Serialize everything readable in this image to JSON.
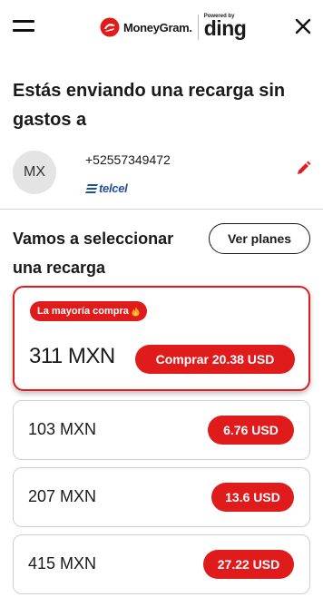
{
  "header": {
    "brand_name": "MoneyGram.",
    "powered_by": "Powered by",
    "partner": "ding"
  },
  "intro": {
    "title": "Estás enviando una recarga sin gastos a"
  },
  "contact": {
    "initials": "MX",
    "phone": "+52557349472",
    "operator": "telcel"
  },
  "plans": {
    "title": "Vamos a seleccionar una recarga",
    "view_plans_label": "Ver planes",
    "featured": {
      "badge": "La mayoría compra",
      "amount": "311 MXN",
      "button_label": "Comprar 20.38 USD"
    },
    "items": [
      {
        "amount": "103 MXN",
        "price": "6.76 USD"
      },
      {
        "amount": "207 MXN",
        "price": "13.6 USD"
      },
      {
        "amount": "415 MXN",
        "price": "27.22 USD"
      }
    ]
  },
  "colors": {
    "accent": "#e01b1b",
    "operator_blue": "#1d4fa3"
  }
}
